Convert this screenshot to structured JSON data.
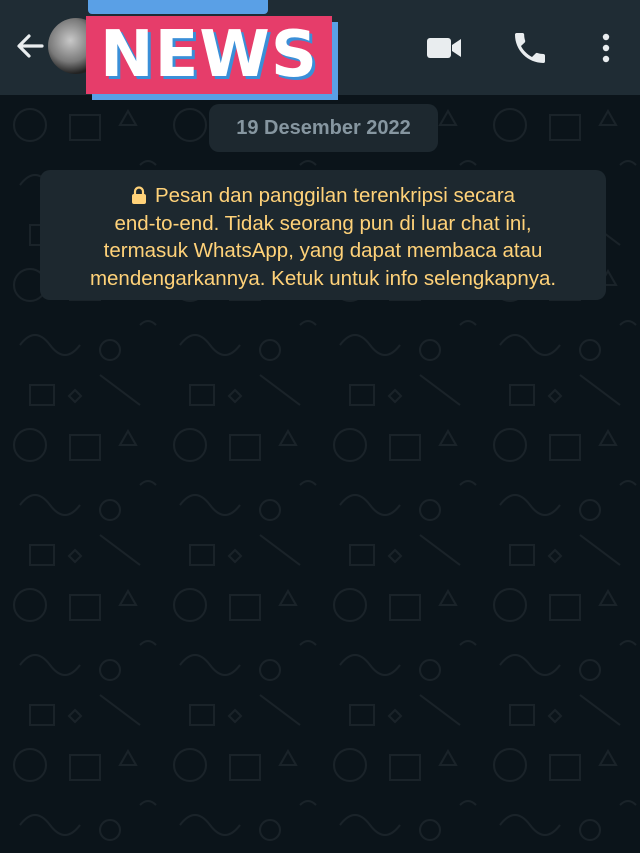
{
  "header": {
    "back_icon": "arrow-left-icon",
    "contact_sticker_text": "NEWS",
    "actions": [
      {
        "icon": "video-camera-icon"
      },
      {
        "icon": "phone-icon"
      },
      {
        "icon": "more-vertical-icon"
      }
    ]
  },
  "chat": {
    "date_label": "19 Desember 2022",
    "encryption_notice": {
      "icon": "lock-icon",
      "lines": [
        "Pesan dan panggilan terenkripsi secara",
        "end-to-end. Tidak seorang pun di luar chat ini,",
        "termasuk WhatsApp, yang dapat membaca atau",
        "mendengarkannya. Ketuk untuk info selengkapnya."
      ]
    }
  },
  "colors": {
    "header_bg": "#1f2c34",
    "chat_bg": "#0b141a",
    "chip_bg": "#1d282f",
    "date_text": "#8696a0",
    "notice_text": "#ffd279",
    "sticker_red": "#e63d6a",
    "sticker_blue": "#5aa0e6"
  }
}
